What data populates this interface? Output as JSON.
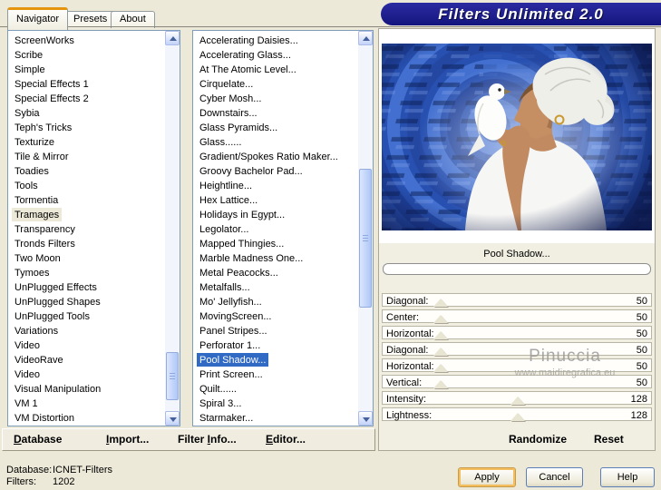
{
  "window": {
    "title_banner": "Filters Unlimited 2.0"
  },
  "tabs": [
    {
      "label": "Navigator",
      "active": true
    },
    {
      "label": "Presets",
      "active": false
    },
    {
      "label": "About",
      "active": false
    }
  ],
  "category_list": {
    "items": [
      "ScreenWorks",
      "Scribe",
      "Simple",
      "Special Effects 1",
      "Special Effects 2",
      "Sybia",
      "Teph's Tricks",
      "Texturize",
      "Tile & Mirror",
      "Toadies",
      "Tools",
      "Tormentia",
      "Tramages",
      "Transparency",
      "Tronds Filters",
      "Two Moon",
      "Tymoes",
      "UnPlugged Effects",
      "UnPlugged Shapes",
      "UnPlugged Tools",
      "Variations",
      "Video",
      "VideoRave",
      "Video",
      "Visual Manipulation",
      "VM 1",
      "VM Distortion"
    ],
    "selected_index": 12,
    "selected_label": "Tramages"
  },
  "filter_list": {
    "items": [
      "Accelerating Daisies...",
      "Accelerating Glass...",
      "At The Atomic Level...",
      "Cirquelate...",
      "Cyber Mosh...",
      "Downstairs...",
      "Glass Pyramids...",
      "Glass......",
      "Gradient/Spokes Ratio Maker...",
      "Groovy Bachelor Pad...",
      "Heightline...",
      "Hex Lattice...",
      "Holidays in Egypt...",
      "Legolator...",
      "Mapped Thingies...",
      "Marble Madness One...",
      "Metal Peacocks...",
      "Metalfalls...",
      "Mo' Jellyfish...",
      "MovingScreen...",
      "Panel Stripes...",
      "Perforator 1...",
      "Pool Shadow...",
      "Print Screen...",
      "Quilt......",
      "Spiral 3...",
      "Starmaker..."
    ],
    "selected_index": 22,
    "selected_label": "Pool Shadow..."
  },
  "preview": {
    "filter_name": "Pool Shadow...",
    "image_alt": "Woman in white headscarf holding a white dove, blue rippled background",
    "watermark_line1": "Pinuccia",
    "watermark_line2": "www.maidiregrafica.eu"
  },
  "sliders": {
    "max": 255,
    "items": [
      {
        "label": "Diagonal:",
        "value": 50
      },
      {
        "label": "Center:",
        "value": 50
      },
      {
        "label": "Horizontal:",
        "value": 50
      },
      {
        "label": "Diagonal:",
        "value": 50
      },
      {
        "label": "Horizontal:",
        "value": 50
      },
      {
        "label": "Vertical:",
        "value": 50
      },
      {
        "label": "Intensity:",
        "value": 128
      },
      {
        "label": "Lightness:",
        "value": 128
      }
    ]
  },
  "panel_actions": {
    "randomize": "Randomize",
    "reset": "Reset"
  },
  "toolbar": {
    "items": [
      {
        "pre": "",
        "key": "D",
        "post": "atabase"
      },
      {
        "pre": "",
        "key": "I",
        "post": "mport..."
      },
      {
        "pre": "Filter ",
        "key": "I",
        "post": "nfo..."
      },
      {
        "pre": "",
        "key": "E",
        "post": "ditor..."
      }
    ]
  },
  "status": {
    "database_label": "Database:",
    "database_value": "ICNET-Filters",
    "filters_label": "Filters:",
    "filters_value": "1202"
  },
  "buttons": {
    "apply": "Apply",
    "cancel": "Cancel",
    "help": "Help"
  },
  "colors": {
    "dialog_bg": "#ECE9D8",
    "banner_navy": "#1A1A8C",
    "selection_blue": "#316AC5",
    "inactive_selection": "#ECE9D8",
    "tab_accent_orange": "#E5940E",
    "apply_focus_ring": "#F4BE5E"
  }
}
